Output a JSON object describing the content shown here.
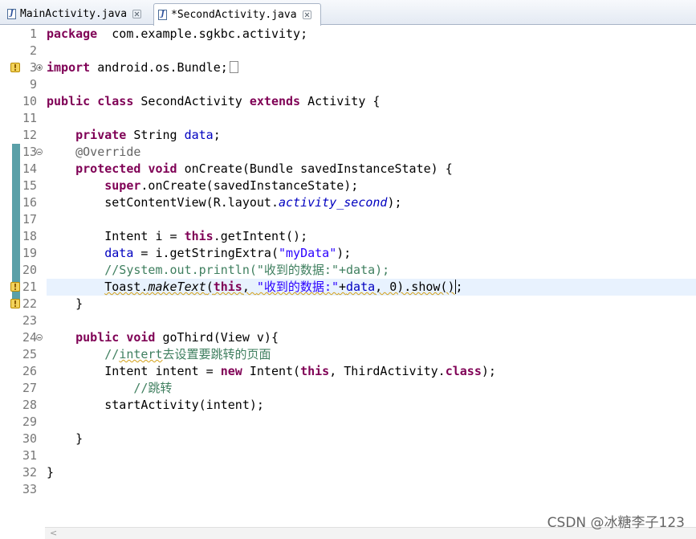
{
  "tabs": [
    {
      "label": "MainActivity.java",
      "icon": "java-file-icon",
      "active": false
    },
    {
      "label": "*SecondActivity.java",
      "icon": "java-file-icon",
      "active": true
    }
  ],
  "lines": [
    {
      "n": "1",
      "tokens": [
        [
          "kw",
          "package"
        ],
        [
          "",
          "  com.example.sgkbc.activity;"
        ]
      ]
    },
    {
      "n": "2",
      "tokens": []
    },
    {
      "n": "3",
      "tokens": [
        [
          "kw",
          "import"
        ],
        [
          "",
          " android.os.Bundle;"
        ]
      ],
      "collapsed": true,
      "warn": true
    },
    {
      "n": "9",
      "tokens": []
    },
    {
      "n": "10",
      "tokens": [
        [
          "kw",
          "public"
        ],
        [
          "",
          " "
        ],
        [
          "kw",
          "class"
        ],
        [
          "",
          " SecondActivity "
        ],
        [
          "kw",
          "extends"
        ],
        [
          "",
          " Activity {"
        ]
      ]
    },
    {
      "n": "11",
      "tokens": []
    },
    {
      "n": "12",
      "tokens": [
        [
          "",
          "    "
        ],
        [
          "kw",
          "private"
        ],
        [
          "",
          " String "
        ],
        [
          "fld",
          "data"
        ],
        [
          "",
          ";"
        ]
      ]
    },
    {
      "n": "13",
      "tokens": [
        [
          "",
          "    "
        ],
        [
          "ann",
          "@Override"
        ]
      ],
      "fold": true
    },
    {
      "n": "14",
      "tokens": [
        [
          "",
          "    "
        ],
        [
          "kw",
          "protected"
        ],
        [
          "",
          " "
        ],
        [
          "kw",
          "void"
        ],
        [
          "",
          " onCreate(Bundle savedInstanceState) {"
        ]
      ]
    },
    {
      "n": "15",
      "tokens": [
        [
          "",
          "        "
        ],
        [
          "kw",
          "super"
        ],
        [
          "",
          ".onCreate(savedInstanceState);"
        ]
      ]
    },
    {
      "n": "16",
      "tokens": [
        [
          "",
          "        setContentView(R.layout."
        ],
        [
          "fld ital",
          "activity_second"
        ],
        [
          "",
          ");"
        ]
      ]
    },
    {
      "n": "17",
      "tokens": []
    },
    {
      "n": "18",
      "tokens": [
        [
          "",
          "        Intent i = "
        ],
        [
          "kw",
          "this"
        ],
        [
          "",
          ".getIntent();"
        ]
      ]
    },
    {
      "n": "19",
      "tokens": [
        [
          "",
          "        "
        ],
        [
          "fld",
          "data"
        ],
        [
          "",
          " = i.getStringExtra("
        ],
        [
          "str",
          "\"myData\""
        ],
        [
          "",
          ");"
        ]
      ]
    },
    {
      "n": "20",
      "tokens": [
        [
          "",
          "        "
        ],
        [
          "cmt",
          "//System.out.println(\"收到的数据:\"+data);"
        ]
      ]
    },
    {
      "n": "21",
      "tokens": [
        [
          "",
          "        "
        ],
        [
          "squiggle",
          "Toast."
        ],
        [
          "squiggle ital",
          "makeText"
        ],
        [
          "squiggle",
          "("
        ],
        [
          "squiggle kw",
          "this"
        ],
        [
          "squiggle",
          ", "
        ],
        [
          "squiggle str",
          "\"收到的数据:\""
        ],
        [
          "squiggle",
          "+"
        ],
        [
          "squiggle fld",
          "data"
        ],
        [
          "squiggle",
          ", 0).show()"
        ],
        [
          "cursor",
          ";"
        ]
      ],
      "current": true,
      "warn": true
    },
    {
      "n": "22",
      "tokens": [
        [
          "",
          "    }"
        ]
      ],
      "warn": true
    },
    {
      "n": "23",
      "tokens": []
    },
    {
      "n": "24",
      "tokens": [
        [
          "",
          "    "
        ],
        [
          "kw",
          "public"
        ],
        [
          "",
          " "
        ],
        [
          "kw",
          "void"
        ],
        [
          "",
          " goThird(View v){"
        ]
      ],
      "fold": true
    },
    {
      "n": "25",
      "tokens": [
        [
          "",
          "        "
        ],
        [
          "cmt",
          "//"
        ],
        [
          "cmt squiggle",
          "intert"
        ],
        [
          "cmt",
          "去设置要跳转的页面"
        ]
      ]
    },
    {
      "n": "26",
      "tokens": [
        [
          "",
          "        Intent intent = "
        ],
        [
          "kw",
          "new"
        ],
        [
          "",
          " Intent("
        ],
        [
          "kw",
          "this"
        ],
        [
          "",
          ", ThirdActivity."
        ],
        [
          "kw",
          "class"
        ],
        [
          "",
          ");"
        ]
      ]
    },
    {
      "n": "27",
      "tokens": [
        [
          "",
          "            "
        ],
        [
          "cmt",
          "//跳转"
        ]
      ]
    },
    {
      "n": "28",
      "tokens": [
        [
          "",
          "        startActivity(intent);"
        ]
      ]
    },
    {
      "n": "29",
      "tokens": []
    },
    {
      "n": "30",
      "tokens": [
        [
          "",
          "    }"
        ]
      ]
    },
    {
      "n": "31",
      "tokens": []
    },
    {
      "n": "32",
      "tokens": [
        [
          "",
          "}"
        ]
      ]
    },
    {
      "n": "33",
      "tokens": []
    }
  ],
  "watermark": "CSDN @冰糖李子123",
  "colors": {
    "keyword": "#7f0055",
    "field": "#0000c0",
    "string": "#2a00ff",
    "comment": "#3f7f5f",
    "annotation": "#646464",
    "current_line": "#e8f2fe"
  }
}
